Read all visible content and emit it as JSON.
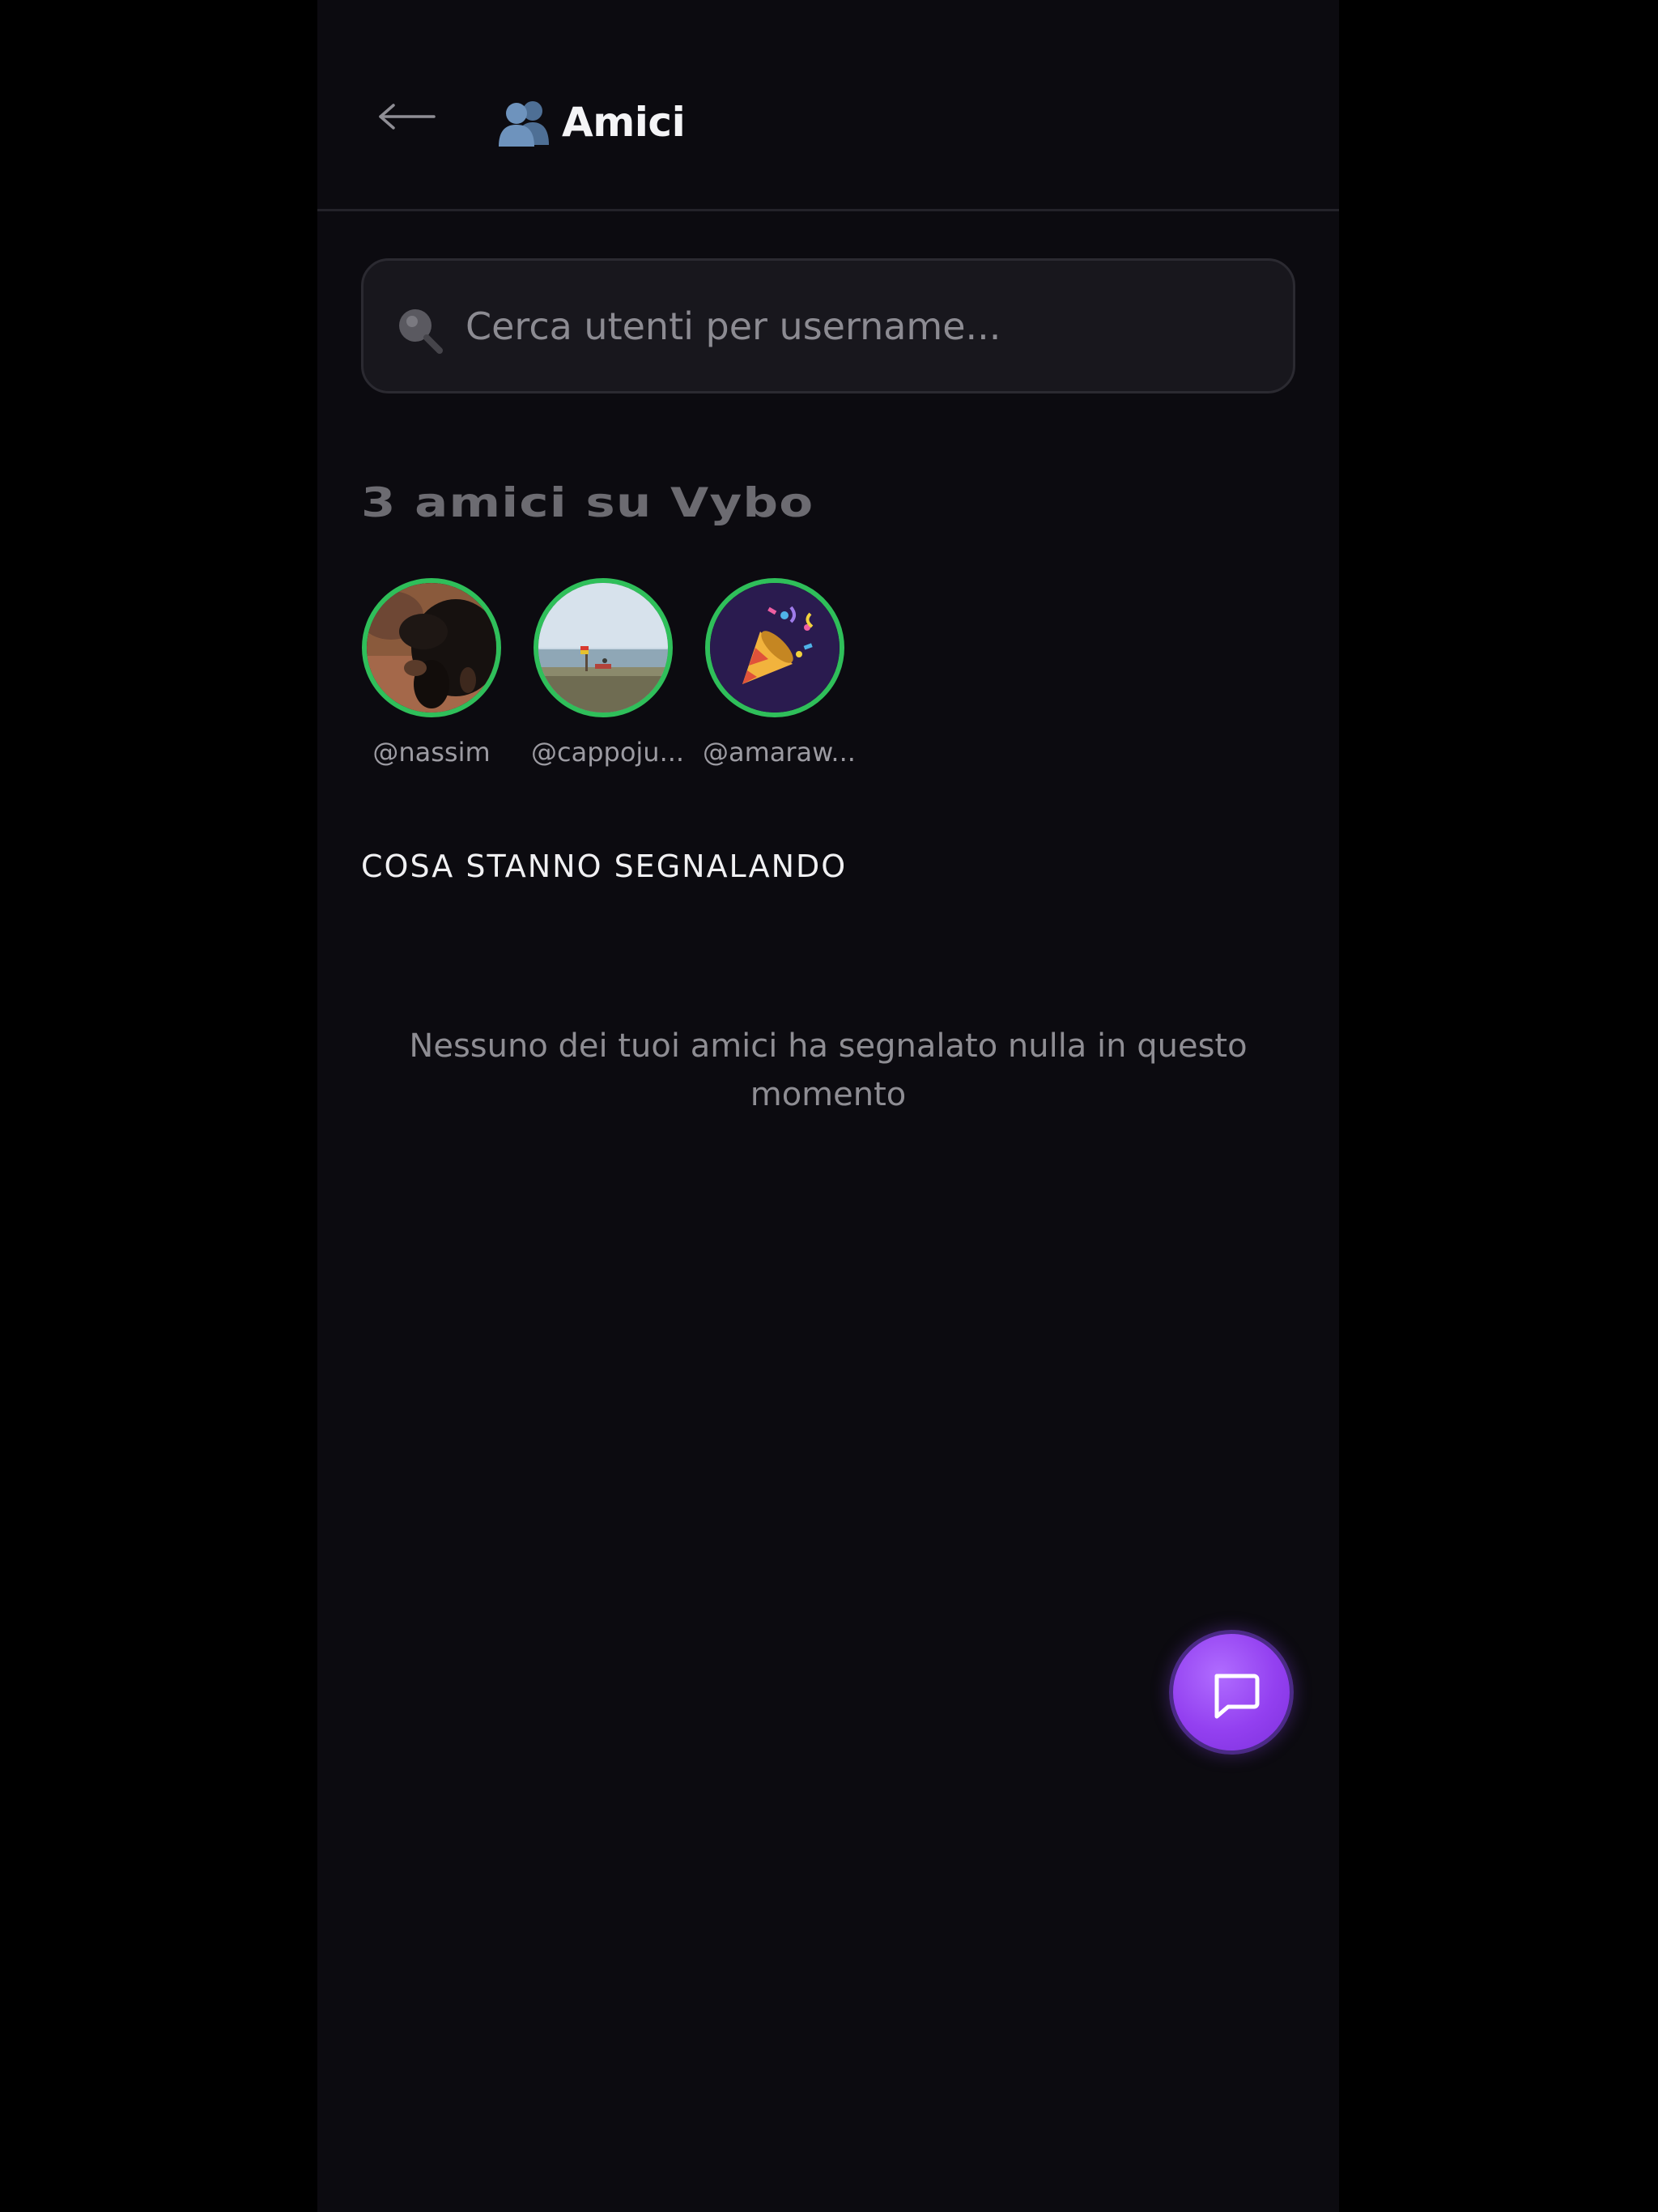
{
  "header": {
    "title": "Amici",
    "back_icon": "arrow-left-icon",
    "title_icon": "two-people-emoji"
  },
  "search": {
    "placeholder": "Cerca utenti per username...",
    "value": "",
    "icon": "search-icon"
  },
  "friends": {
    "count_label": "3 amici su Vybo",
    "items": [
      {
        "handle": "@nassim",
        "avatar": "dog-photo"
      },
      {
        "handle": "@cappoju...",
        "avatar": "beach-photo"
      },
      {
        "handle": "@amaraw...",
        "avatar": "party-popper-emoji"
      }
    ]
  },
  "reports": {
    "section_title": "COSA STANNO SEGNALANDO",
    "empty_message": "Nessuno dei tuoi amici ha segnalato nulla in questo momento"
  },
  "fab": {
    "icon": "chat-bubble-icon"
  },
  "colors": {
    "background": "#0c0b10",
    "online_ring": "#2fbf5a",
    "accent": "#9340f0"
  }
}
